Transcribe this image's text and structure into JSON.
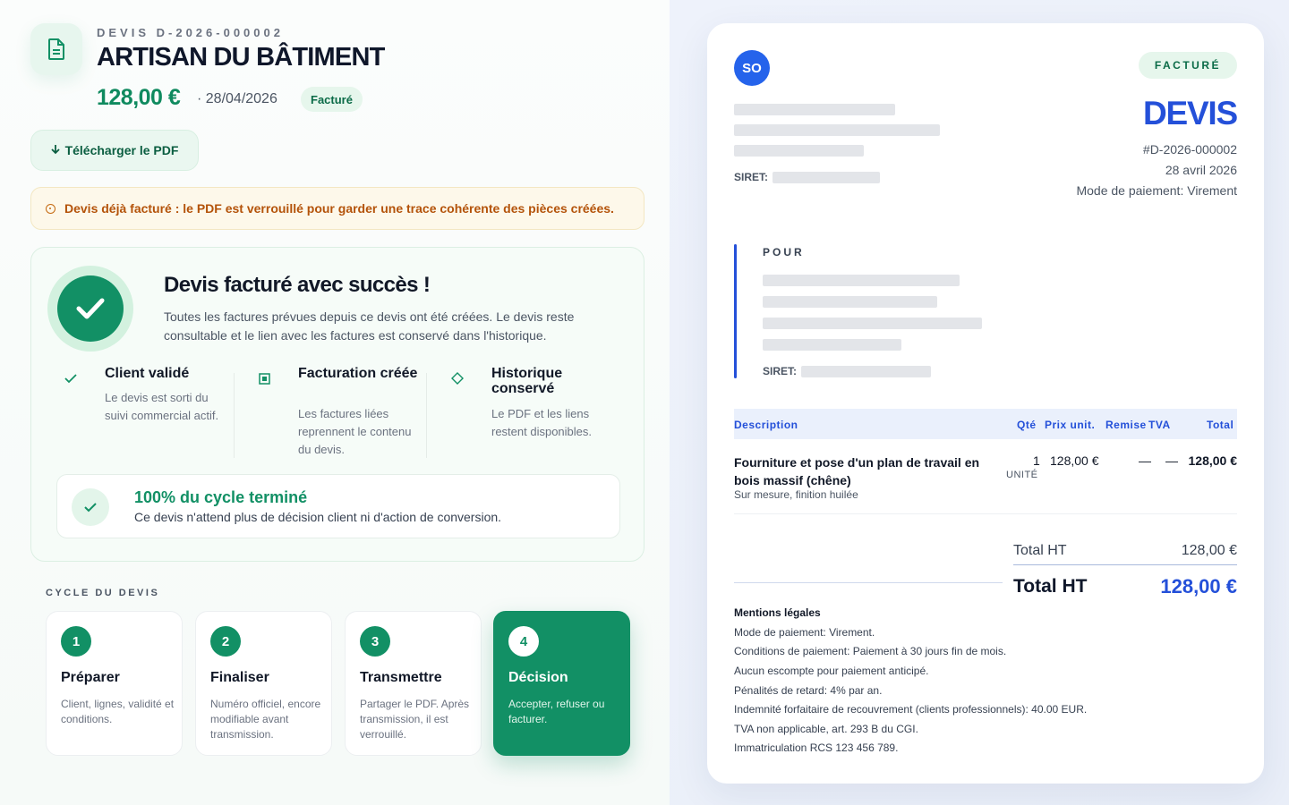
{
  "header": {
    "ref": "DEVIS D-2026-000002",
    "title": "ARTISAN DU BÂTIMENT",
    "amount": "128,00 €",
    "date": "· 28/04/2026",
    "status_badge": "Facturé",
    "download_label": "Télécharger le PDF"
  },
  "warning": {
    "text": "Devis déjà facturé : le PDF est verrouillé pour garder une trace cohérente des pièces créées."
  },
  "success": {
    "title": "Devis facturé avec succès !",
    "text": "Toutes les factures prévues depuis ce devis ont été créées. Le devis reste consultable et le lien avec les factures est conservé dans l'historique.",
    "features": [
      {
        "title": "Client validé",
        "desc": "Le devis est sorti du suivi commercial actif.",
        "icon": "check-icon"
      },
      {
        "title": "Facturation créée",
        "desc": "Les factures liées reprennent le contenu du devis.",
        "icon": "square-icon"
      },
      {
        "title": "Historique conservé",
        "desc": "Le PDF et les liens restent disponibles.",
        "icon": "diamond-icon"
      }
    ],
    "cycle_done": {
      "title": "100% du cycle terminé",
      "text": "Ce devis n'attend plus de décision client ni d'action de conversion."
    }
  },
  "cycle": {
    "label": "CYCLE DU DEVIS",
    "steps": [
      {
        "num": "1",
        "title": "Préparer",
        "desc": "Client, lignes, validité et conditions."
      },
      {
        "num": "2",
        "title": "Finaliser",
        "desc": "Numéro officiel, encore modifiable avant transmission."
      },
      {
        "num": "3",
        "title": "Transmettre",
        "desc": "Partager le PDF. Après transmission, il est verrouillé."
      },
      {
        "num": "4",
        "title": "Décision",
        "desc": "Accepter, refuser ou facturer."
      }
    ]
  },
  "invoice": {
    "avatar": "SO",
    "siret_label": "SIRET:",
    "badge": "FACTURÉ",
    "title": "DEVIS",
    "number": "#D-2026-000002",
    "date": "28 avril 2026",
    "payment_mode": "Mode de paiement: Virement",
    "pour_label": "POUR",
    "table": {
      "headers": {
        "description": "Description",
        "qty": "Qté",
        "unit_price": "Prix unit.",
        "discount": "Remise",
        "vat": "TVA",
        "total": "Total"
      },
      "rows": [
        {
          "description": "Fourniture et pose d'un plan de travail en bois massif (chêne)",
          "sub": "Sur mesure, finition huilée",
          "qty": "1",
          "unit": "UNITÉ",
          "unit_price": "128,00 €",
          "discount": "—",
          "vat": "—",
          "total": "128,00 €"
        }
      ]
    },
    "totals": {
      "ht_label": "Total HT",
      "ht_value": "128,00 €",
      "total_label": "Total HT",
      "total_value": "128,00 €"
    },
    "legal": {
      "title": "Mentions légales",
      "lines": [
        "Mode de paiement: Virement.",
        "Conditions de paiement: Paiement à 30 jours fin de mois.",
        "Aucun escompte pour paiement anticipé.",
        "Pénalités de retard: 4% par an.",
        "Indemnité forfaitaire de recouvrement (clients professionnels): 40.00 EUR.",
        "TVA non applicable, art. 293 B du CGI.",
        "Immatriculation RCS 123 456 789."
      ]
    }
  },
  "colors": {
    "accent_green": "#129065",
    "accent_blue": "#2450d9",
    "warning": "#b4530a"
  }
}
